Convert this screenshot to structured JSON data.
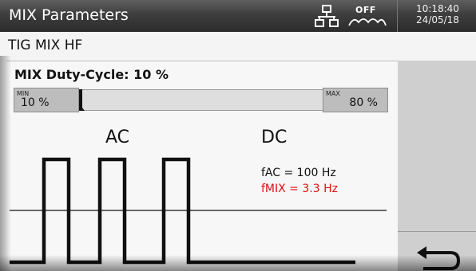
{
  "header": {
    "title": "MIX Parameters",
    "off_label": "OFF",
    "time": "10:18:40",
    "date": "24/05/18",
    "icons": [
      "network-icon",
      "wave-off-icon"
    ]
  },
  "mode": {
    "text": "TIG MIX HF"
  },
  "duty_cycle": {
    "title": "MIX Duty-Cycle: 10 %",
    "min_tag": "MIN",
    "min_value": "10 %",
    "max_tag": "MAX",
    "max_value": "80 %",
    "slider_level_percent": 10
  },
  "diagram": {
    "label_ac": "AC",
    "label_dc": "DC",
    "fac": "fAC = 100 Hz",
    "fmix": "fMIX = 3.3 Hz",
    "fmix_color": "#e01010"
  },
  "right_panel": {
    "back_icon": "return-arrow-icon"
  }
}
